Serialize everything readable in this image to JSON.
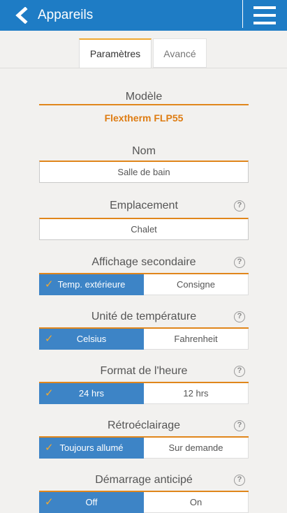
{
  "header": {
    "title": "Appareils",
    "back_icon": "chevron-left-icon",
    "menu_icon": "hamburger-menu-icon"
  },
  "tabs": [
    {
      "label": "Paramètres",
      "active": true
    },
    {
      "label": "Avancé",
      "active": false
    }
  ],
  "model": {
    "label": "Modèle",
    "value": "Flextherm FLP55"
  },
  "name": {
    "label": "Nom",
    "value": "Salle de bain"
  },
  "location": {
    "label": "Emplacement",
    "value": "Chalet"
  },
  "secondary_display": {
    "label": "Affichage secondaire",
    "options": [
      "Temp. extérieure",
      "Consigne"
    ],
    "selected": 0
  },
  "temp_unit": {
    "label": "Unité de température",
    "options": [
      "Celsius",
      "Fahrenheit"
    ],
    "selected": 0
  },
  "time_format": {
    "label": "Format de l'heure",
    "options": [
      "24 hrs",
      "12 hrs"
    ],
    "selected": 0
  },
  "backlight": {
    "label": "Rétroéclairage",
    "options": [
      "Toujours allumé",
      "Sur demande"
    ],
    "selected": 0
  },
  "early_start": {
    "label": "Démarrage anticipé",
    "options": [
      "Off",
      "On"
    ],
    "selected": 0
  },
  "help_glyph": "?",
  "check_glyph": "✓",
  "colors": {
    "header": "#1e7cc5",
    "accent": "#e0861b",
    "selected": "#3d84c6",
    "check": "#f0a830"
  }
}
